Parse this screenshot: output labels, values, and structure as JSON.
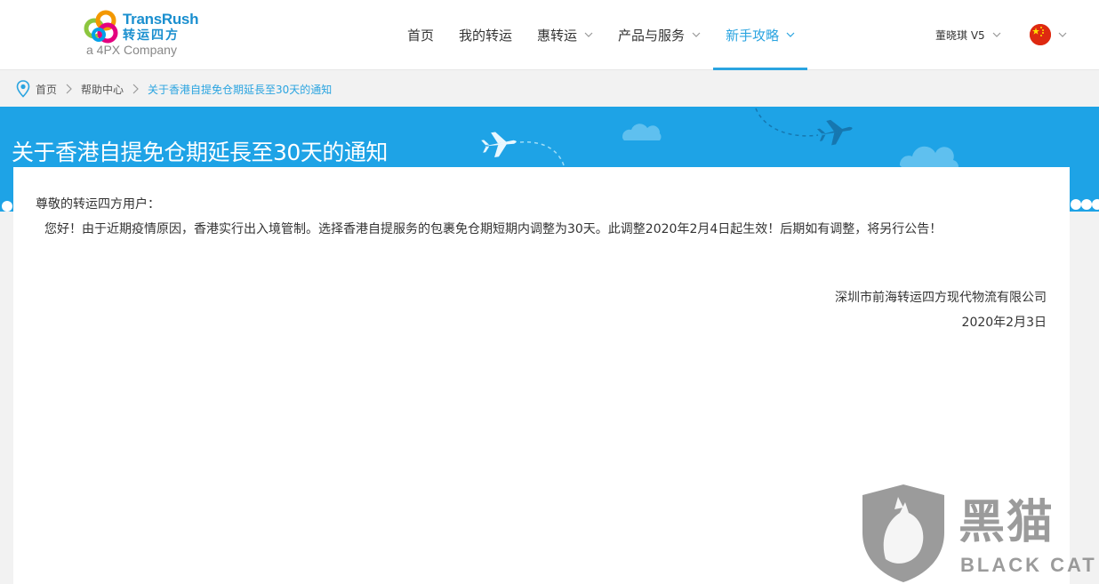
{
  "header": {
    "logo": {
      "brand_en": "TransRush",
      "brand_cn": "转运四方",
      "tagline": "a 4PX Company"
    },
    "nav": [
      {
        "label": "首页",
        "has_dropdown": false,
        "active": false
      },
      {
        "label": "我的转运",
        "has_dropdown": false,
        "active": false
      },
      {
        "label": "惠转运",
        "has_dropdown": true,
        "active": false
      },
      {
        "label": "产品与服务",
        "has_dropdown": true,
        "active": false
      },
      {
        "label": "新手攻略",
        "has_dropdown": true,
        "active": true
      }
    ],
    "user": {
      "name": "董晓琪 V5"
    },
    "language": {
      "flag": "china-flag-icon"
    }
  },
  "breadcrumb": {
    "items": [
      "首页",
      "帮助中心",
      "关于香港自提免仓期延長至30天的通知"
    ]
  },
  "banner": {
    "title": "关于香港自提免仓期延長至30天的通知"
  },
  "notice": {
    "greeting": "尊敬的转运四方用户：",
    "body": "您好！由于近期疫情原因，香港实行出入境管制。选择香港自提服务的包裹免仓期短期内调整为30天。此调整2020年2月4日起生效！后期如有调整，将另行公告！",
    "company": "深圳市前海转运四方现代物流有限公司",
    "date": "2020年2月3日"
  },
  "watermark": {
    "cn": "黑猫",
    "en": "BLACK CAT"
  },
  "colors": {
    "accent": "#2aa4e0",
    "banner": "#1ea3e6",
    "page_bg": "#f2f2f2"
  }
}
